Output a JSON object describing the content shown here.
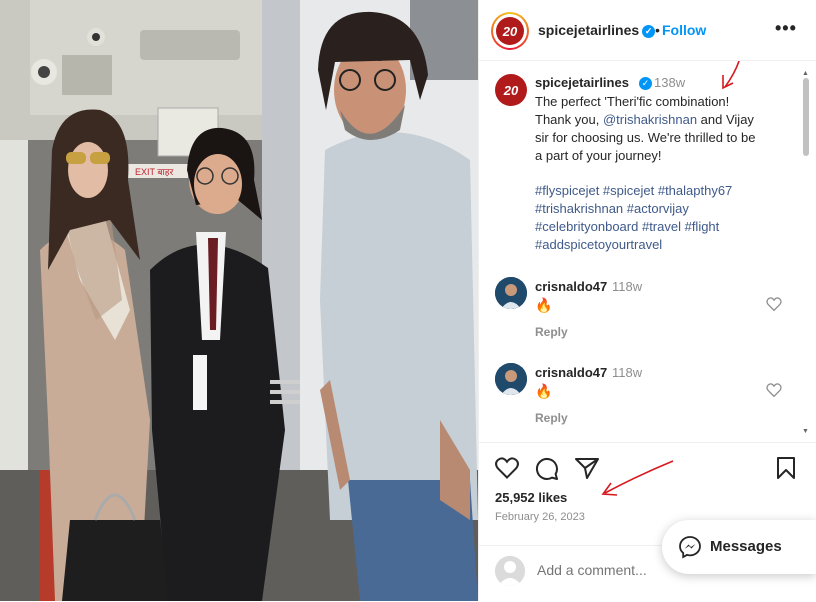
{
  "post": {
    "author": "spicejetairlines",
    "follow_label": "Follow",
    "logo_text": "20",
    "more_label": "•••"
  },
  "photo": {
    "sign_text": "EXIT बाहर"
  },
  "caption": {
    "user": "spicejetairlines",
    "time": "138w",
    "line1": "The perfect 'Theri'fic combination!",
    "line2_prefix": "Thank you, ",
    "mention": "@trishakrishnan",
    "line2_suffix": " and Vijay",
    "line3": "sir for choosing us. We're thrilled to be",
    "line4": "a part of your journey!",
    "hashtags": [
      "#flyspicejet #spicejet #thalapthy67",
      "#trishakrishnan #actorvijay",
      "#celebrityonboard #travel #flight",
      "#addspicetoyourtravel"
    ]
  },
  "comments": [
    {
      "user": "crisnaldo47",
      "time": "118w",
      "text": "🔥",
      "reply_label": "Reply"
    },
    {
      "user": "crisnaldo47",
      "time": "118w",
      "text": "🔥",
      "reply_label": "Reply"
    }
  ],
  "stats": {
    "likes": "25,952 likes",
    "date": "February 26, 2023"
  },
  "add_comment": {
    "placeholder": "Add a comment..."
  },
  "messages": {
    "label": "Messages"
  },
  "icons": {
    "like": "heart-icon",
    "comment": "comment-icon",
    "share": "paper-plane-icon",
    "save": "bookmark-icon",
    "messages": "messenger-icon"
  },
  "colors": {
    "link": "#0095f6",
    "hashtag": "#3f5a8a",
    "brand": "#b11a1a",
    "annotation": "#d7191f"
  }
}
